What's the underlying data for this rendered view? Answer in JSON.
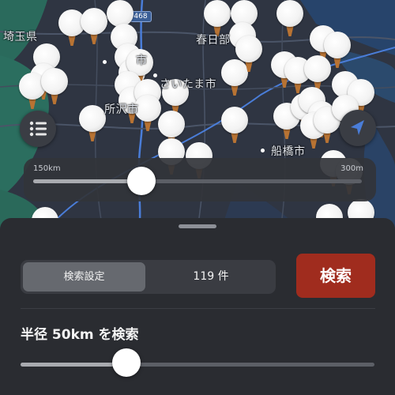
{
  "map": {
    "labels": [
      {
        "id": "saitama-ken",
        "text": "埼玉県"
      },
      {
        "id": "kasukabe",
        "text": "春日部"
      },
      {
        "id": "shi-top",
        "text": "市"
      },
      {
        "id": "saitama-shi",
        "text": "さいたま市"
      },
      {
        "id": "tokorozawa",
        "text": "所沢市"
      },
      {
        "id": "funabashi",
        "text": "船橋市"
      }
    ],
    "route_badge": "468",
    "colors": {
      "pin_head": "#f3f3f3",
      "pin_stem": "#b87333",
      "accent_blue": "#4a7dd8"
    }
  },
  "controls": {
    "list_icon": "list-icon",
    "locate_icon": "location-arrow-icon"
  },
  "distance_slider": {
    "min_label": "150km",
    "max_label": "300m",
    "value_fraction": 0.33
  },
  "sheet": {
    "segmented": {
      "settings_label": "検索設定",
      "count_label": "119 件"
    },
    "search_button": "検索",
    "radius_label": "半径 50km を検索",
    "radius_fraction": 0.3,
    "colors": {
      "search_button": "#a02c1e"
    }
  }
}
